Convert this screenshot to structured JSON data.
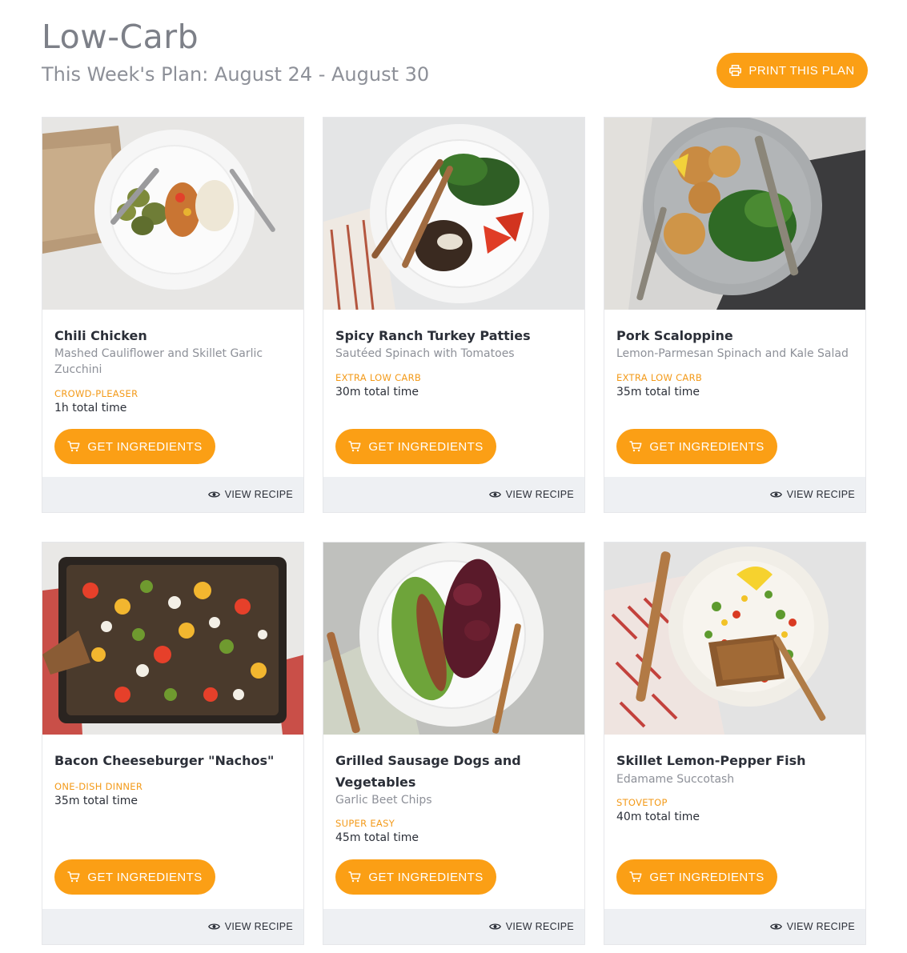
{
  "header": {
    "title": "Low-Carb",
    "week_label": "This Week's Plan: August 24 - August 30",
    "print_label": "PRINT THIS PLAN"
  },
  "labels": {
    "get_ingredients": "GET INGREDIENTS",
    "view_recipe": "VIEW RECIPE"
  },
  "colors": {
    "accent": "#fb9f15",
    "tag": "#f39a19",
    "footer": "#eef0f3"
  },
  "recipes": [
    {
      "title": "Chili Chicken",
      "side": "Mashed Cauliflower and Skillet Garlic Zucchini",
      "tag": "CROWD-PLEASER",
      "time": "1h total time"
    },
    {
      "title": "Spicy Ranch Turkey Patties",
      "side": "Sautéed Spinach with Tomatoes",
      "tag": "EXTRA LOW CARB",
      "time": "30m total time"
    },
    {
      "title": "Pork Scaloppine",
      "side": "Lemon-Parmesan Spinach and Kale Salad",
      "tag": "EXTRA LOW CARB",
      "time": "35m total time"
    },
    {
      "title": "Bacon Cheeseburger \"Nachos\"",
      "side": "",
      "tag": "ONE-DISH DINNER",
      "time": "35m total time"
    },
    {
      "title": "Grilled Sausage Dogs and Vegetables",
      "side": "Garlic Beet Chips",
      "tag": "SUPER EASY",
      "time": "45m total time"
    },
    {
      "title": "Skillet Lemon-Pepper Fish",
      "side": "Edamame Succotash",
      "tag": "STOVETOP",
      "time": "40m total time"
    }
  ]
}
